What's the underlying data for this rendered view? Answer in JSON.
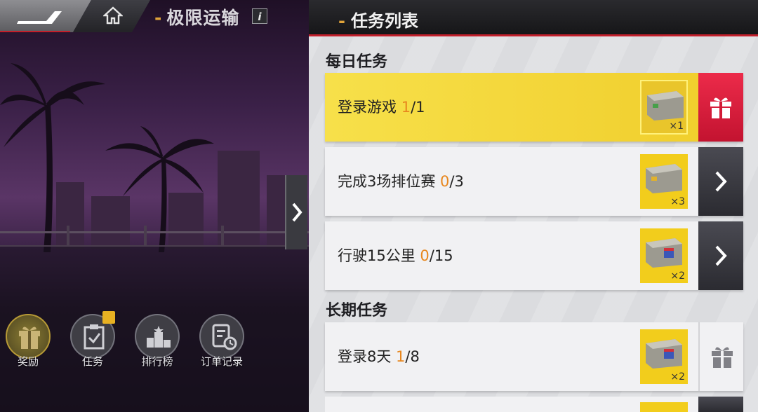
{
  "game": {
    "title": "极限运输",
    "info_label": "i"
  },
  "menu": [
    {
      "label": "奖励",
      "icon": "gift-icon"
    },
    {
      "label": "任务",
      "icon": "task-clipboard-icon"
    },
    {
      "label": "排行榜",
      "icon": "podium-icon"
    },
    {
      "label": "订单记录",
      "icon": "order-record-icon"
    }
  ],
  "panel": {
    "title": "任务列表"
  },
  "sections": {
    "daily": "每日任务",
    "long_term": "长期任务"
  },
  "tasks": [
    {
      "name": "登录游戏 ",
      "current": "1",
      "total": "/1",
      "reward_qty": "×1",
      "action": "claim-gift"
    },
    {
      "name": "完成3场排位赛 ",
      "current": "0",
      "total": "/3",
      "reward_qty": "×3",
      "action": "go"
    },
    {
      "name": "行驶15公里 ",
      "current": "0",
      "total": "/15",
      "reward_qty": "×2",
      "action": "go"
    },
    {
      "name": "登录8天 ",
      "current": "1",
      "total": "/8",
      "reward_qty": "×2",
      "action": "locked-gift"
    }
  ],
  "colors": {
    "accent_red": "#c21f2b",
    "progress_orange": "#e8871e",
    "completed_yellow": "#f0cd2a",
    "claim_red": "#e01e3c"
  }
}
